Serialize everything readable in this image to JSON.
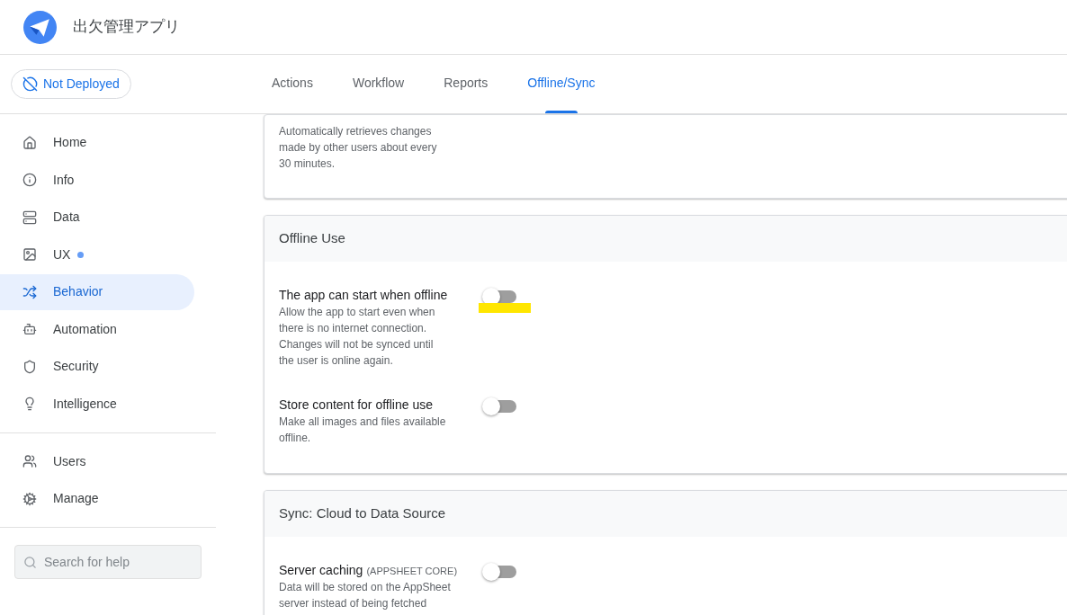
{
  "app": {
    "title": "出欠管理アプリ"
  },
  "deploy_status": {
    "label": "Not Deployed"
  },
  "sidebar": {
    "groups": [
      {
        "items": [
          {
            "label": "Home",
            "selected": false,
            "dot": false
          },
          {
            "label": "Info",
            "selected": false,
            "dot": false
          },
          {
            "label": "Data",
            "selected": false,
            "dot": false
          },
          {
            "label": "UX",
            "selected": false,
            "dot": true
          },
          {
            "label": "Behavior",
            "selected": true,
            "dot": false
          },
          {
            "label": "Automation",
            "selected": false,
            "dot": false
          },
          {
            "label": "Security",
            "selected": false,
            "dot": false
          },
          {
            "label": "Intelligence",
            "selected": false,
            "dot": false
          }
        ]
      },
      {
        "items": [
          {
            "label": "Users",
            "selected": false,
            "dot": false
          },
          {
            "label": "Manage",
            "selected": false,
            "dot": false
          }
        ]
      }
    ]
  },
  "search": {
    "placeholder": "Search for help"
  },
  "tabs": [
    {
      "label": "Actions",
      "selected": false
    },
    {
      "label": "Workflow",
      "selected": false
    },
    {
      "label": "Reports",
      "selected": false
    },
    {
      "label": "Offline/Sync",
      "selected": true
    }
  ],
  "sections": [
    {
      "settings": [
        {
          "description": "Automatically retrieves changes\nmade by other users about every\n30 minutes."
        }
      ]
    },
    {
      "title": "Offline Use",
      "settings": [
        {
          "title": "The app can start when offline",
          "description": "Allow the app to start even when\nthere is no internet connection.\nChanges will not be synced until\nthe user is online again.",
          "on": false,
          "highlighted": true
        },
        {
          "title": "Store content for offline use",
          "description": "Make all images and files available\noffline.",
          "on": false,
          "highlighted": false
        }
      ]
    },
    {
      "title": "Sync: Cloud to Data Source",
      "settings": [
        {
          "title": "Server caching",
          "note": "(APPSHEET CORE)",
          "description": "Data will be stored on the AppSheet\nserver instead of being fetched",
          "on": false,
          "highlighted": false
        }
      ]
    }
  ]
}
